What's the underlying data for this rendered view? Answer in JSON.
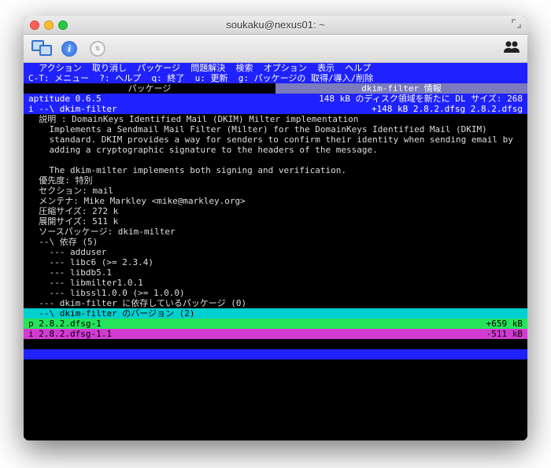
{
  "window": {
    "title": "soukaku@nexus01: ~"
  },
  "menubar": "  アクション  取り消し  パッケージ  問題解決  検索  オプション  表示  ヘルプ",
  "helpbar": "C-T: メニュー  ?: ヘルプ  q: 終了  u: 更新  g: パッケージの 取得/導入/削除",
  "tabs": {
    "left": "パッケージ",
    "right": "dkim-filter 情報"
  },
  "status": {
    "left": "aptitude 0.6.5",
    "right": "148 kB のディスク領域を新たに  DL サイズ: 268"
  },
  "selected": {
    "left": "i   --\\ dkim-filter",
    "right": "+148 kB 2.8.2.dfsg 2.8.2.dfsg"
  },
  "body": {
    "l01": "  説明 : DomainKeys Identified Mail (DKIM) Milter implementation",
    "l02": "    Implements a Sendmail Mail Filter (Milter) for the DomainKeys Identified Mail (DKIM)",
    "l03": "    standard. DKIM provides a way for senders to confirm their identity when sending email by",
    "l04": "    adding a cryptographic signature to the headers of the message.",
    "l05": "",
    "l06": "    The dkim-milter implements both signing and verification.",
    "l07": "  優先度: 特別",
    "l08": "  セクション: mail",
    "l09": "  メンテナ: Mike Markley <mike@markley.org>",
    "l10": "  圧縮サイズ: 272 k",
    "l11": "  展開サイズ: 511 k",
    "l12": "  ソースパッケージ: dkim-milter",
    "l13": "  --\\ 依存 (5)",
    "l14": "    --- adduser",
    "l15": "    --- libc6 (>= 2.3.4)",
    "l16": "    --- libdb5.1",
    "l17": "    --- libmilter1.0.1",
    "l18": "    --- libssl1.0.0 (>= 1.0.0)",
    "l19": "  --- dkim-filter に依存しているパッケージ (0)"
  },
  "versions_header": "  --\\ dkim-filter のバージョン (2)",
  "versions": {
    "v1": {
      "left": "p   2.8.2.dfsg-1",
      "right": "+659 kB   "
    },
    "v2": {
      "left": "i   2.8.2.dfsg-1.1",
      "right": "-511 kB   "
    }
  }
}
